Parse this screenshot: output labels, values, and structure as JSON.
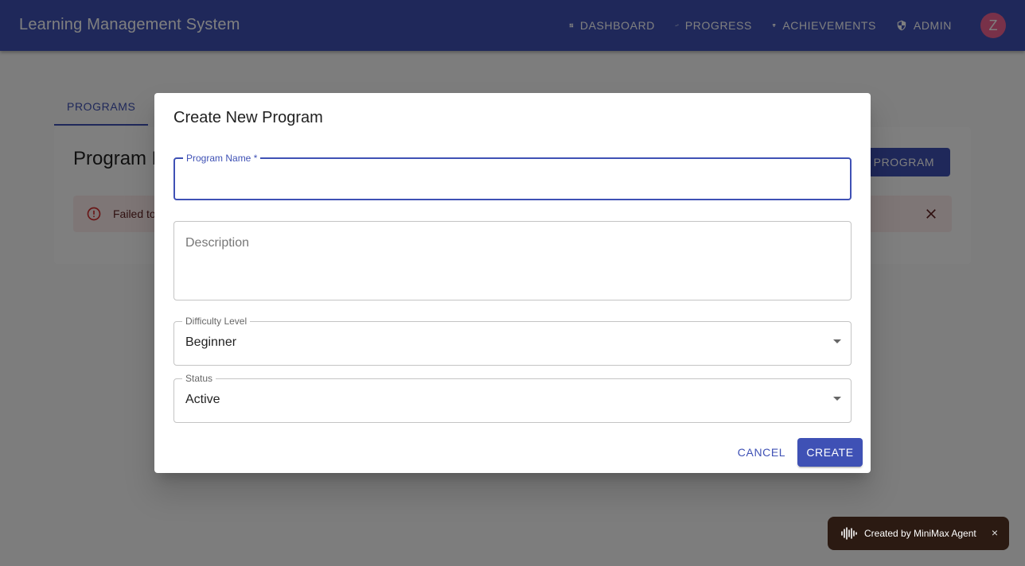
{
  "app": {
    "title": "Learning Management System"
  },
  "nav": {
    "items": [
      {
        "label": "DASHBOARD",
        "icon": "dashboard-icon"
      },
      {
        "label": "PROGRESS",
        "icon": "trending-up-icon"
      },
      {
        "label": "ACHIEVEMENTS",
        "icon": "trophy-icon"
      },
      {
        "label": "ADMIN",
        "icon": "admin-shield-icon"
      }
    ],
    "avatar_letter": "Z"
  },
  "tabs": [
    {
      "label": "PROGRAMS",
      "active": true
    }
  ],
  "panel": {
    "title": "Program M",
    "create_button": "CREATE PROGRAM",
    "alert_text": "Failed to"
  },
  "dialog": {
    "title": "Create New Program",
    "fields": {
      "name_label": "Program Name *",
      "description_label": "Description",
      "difficulty_label": "Difficulty Level",
      "difficulty_value": "Beginner",
      "status_label": "Status",
      "status_value": "Active"
    },
    "cancel_label": "CANCEL",
    "create_label": "CREATE"
  },
  "toast": {
    "text": "Created by MiniMax Agent",
    "close": "×"
  },
  "colors": {
    "primary": "#3f51b5",
    "alert_bg": "#fdeded",
    "alert_fg": "#5f2120"
  }
}
